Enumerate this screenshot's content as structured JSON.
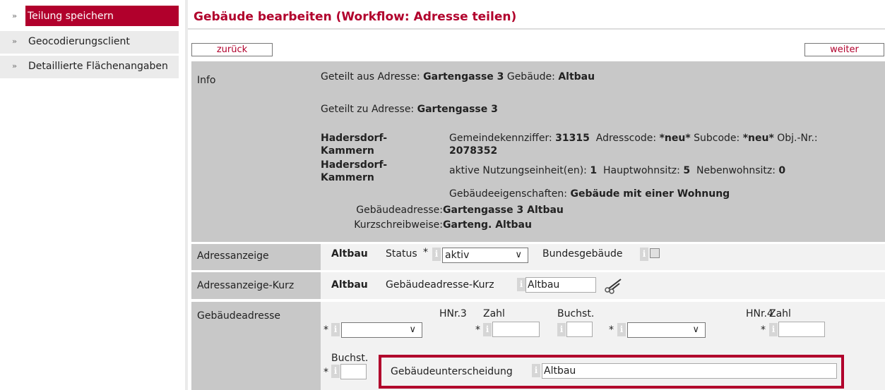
{
  "sidebar": {
    "items": [
      {
        "label": "Teilung speichern",
        "active": true
      },
      {
        "label": "Geocodierungsclient",
        "active": false
      },
      {
        "label": "Detaillierte Flächenangaben",
        "active": false
      }
    ],
    "arrow": "»"
  },
  "header": {
    "title": "Gebäude bearbeiten (Workflow: Adresse teilen)",
    "back_label": "zurück",
    "next_label": "weiter"
  },
  "info": {
    "label": "Info",
    "geteilt_aus_prefix": "Geteilt aus Adresse:",
    "geteilt_aus_value": "Gartengasse 3",
    "gebaeude_prefix": "Gebäude:",
    "gebaeude_value": "Altbau",
    "geteilt_zu_prefix": "Geteilt zu Adresse:",
    "geteilt_zu_value": "Gartengasse 3",
    "ort_1a": "Hadersdorf-",
    "ort_1b": "Kammern",
    "ort_2a": "Hadersdorf-",
    "ort_2b": "Kammern",
    "gkz_label": "Gemeindekennziffer:",
    "gkz_value": "31315",
    "adresscode_label": "Adresscode:",
    "adresscode_value": "*neu*",
    "subcode_label": "Subcode:",
    "subcode_value": "*neu*",
    "objnr_label": "Obj.-Nr.:",
    "objnr_value": "2078352",
    "nutzung_label": "aktive Nutzungseinheit(en):",
    "nutzung_value": "1",
    "hws_label": "Hauptwohnsitz:",
    "hws_value": "5",
    "nws_label": "Nebenwohnsitz:",
    "nws_value": "0",
    "eigenschaften_label": "Gebäudeeigenschaften:",
    "eigenschaften_value": "Gebäude mit einer Wohnung",
    "gebaeudeadresse_label": "Gebäudeadresse:",
    "gebaeudeadresse_value": "Gartengasse 3 Altbau",
    "kurzschreib_label": "Kurzschreibweise:",
    "kurzschreib_value": "Garteng. Altbau"
  },
  "adressanzeige": {
    "label": "Adressanzeige",
    "value": "Altbau",
    "status_label": "Status",
    "status_value": "aktiv",
    "bundes_label": "Bundesgebäude",
    "required_mark": "*",
    "info_glyph": "i"
  },
  "adressanzeige_kurz": {
    "label": "Adressanzeige-Kurz",
    "value": "Altbau",
    "field_label": "Gebäudeadresse-Kurz",
    "field_value": "Altbau"
  },
  "gebaeudeadresse": {
    "label": "Gebäudeadresse",
    "hnr3_label": "HNr.3",
    "zahl1_label": "Zahl",
    "buchst1_label": "Buchst.",
    "hnr4_label": "HNr.4",
    "zahl2_label": "Zahl",
    "buchst2_label": "Buchst.",
    "unterscheidung_label": "Gebäudeunterscheidung",
    "unterscheidung_value": "Altbau",
    "chevron": "∨"
  },
  "colors": {
    "accent": "#b1002c",
    "panel": "#c8c8c8",
    "sidebar": "#ebebeb"
  }
}
